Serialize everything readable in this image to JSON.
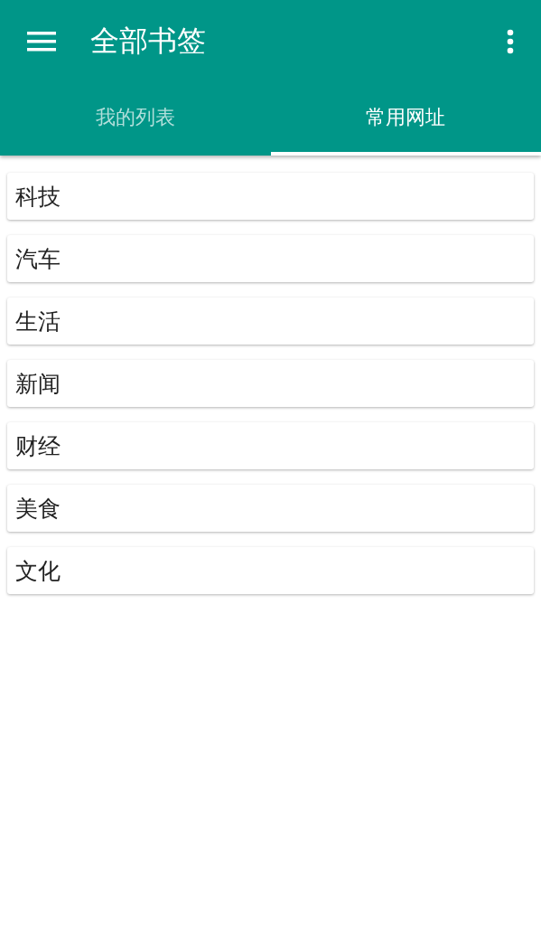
{
  "app_bar": {
    "title": "全部书签"
  },
  "tabs": [
    {
      "label": "我的列表",
      "selected": false
    },
    {
      "label": "常用网址",
      "selected": true
    }
  ],
  "bookmarks": [
    {
      "label": "科技"
    },
    {
      "label": "汽车"
    },
    {
      "label": "生活"
    },
    {
      "label": "新闻"
    },
    {
      "label": "财经"
    },
    {
      "label": "美食"
    },
    {
      "label": "文化"
    }
  ]
}
